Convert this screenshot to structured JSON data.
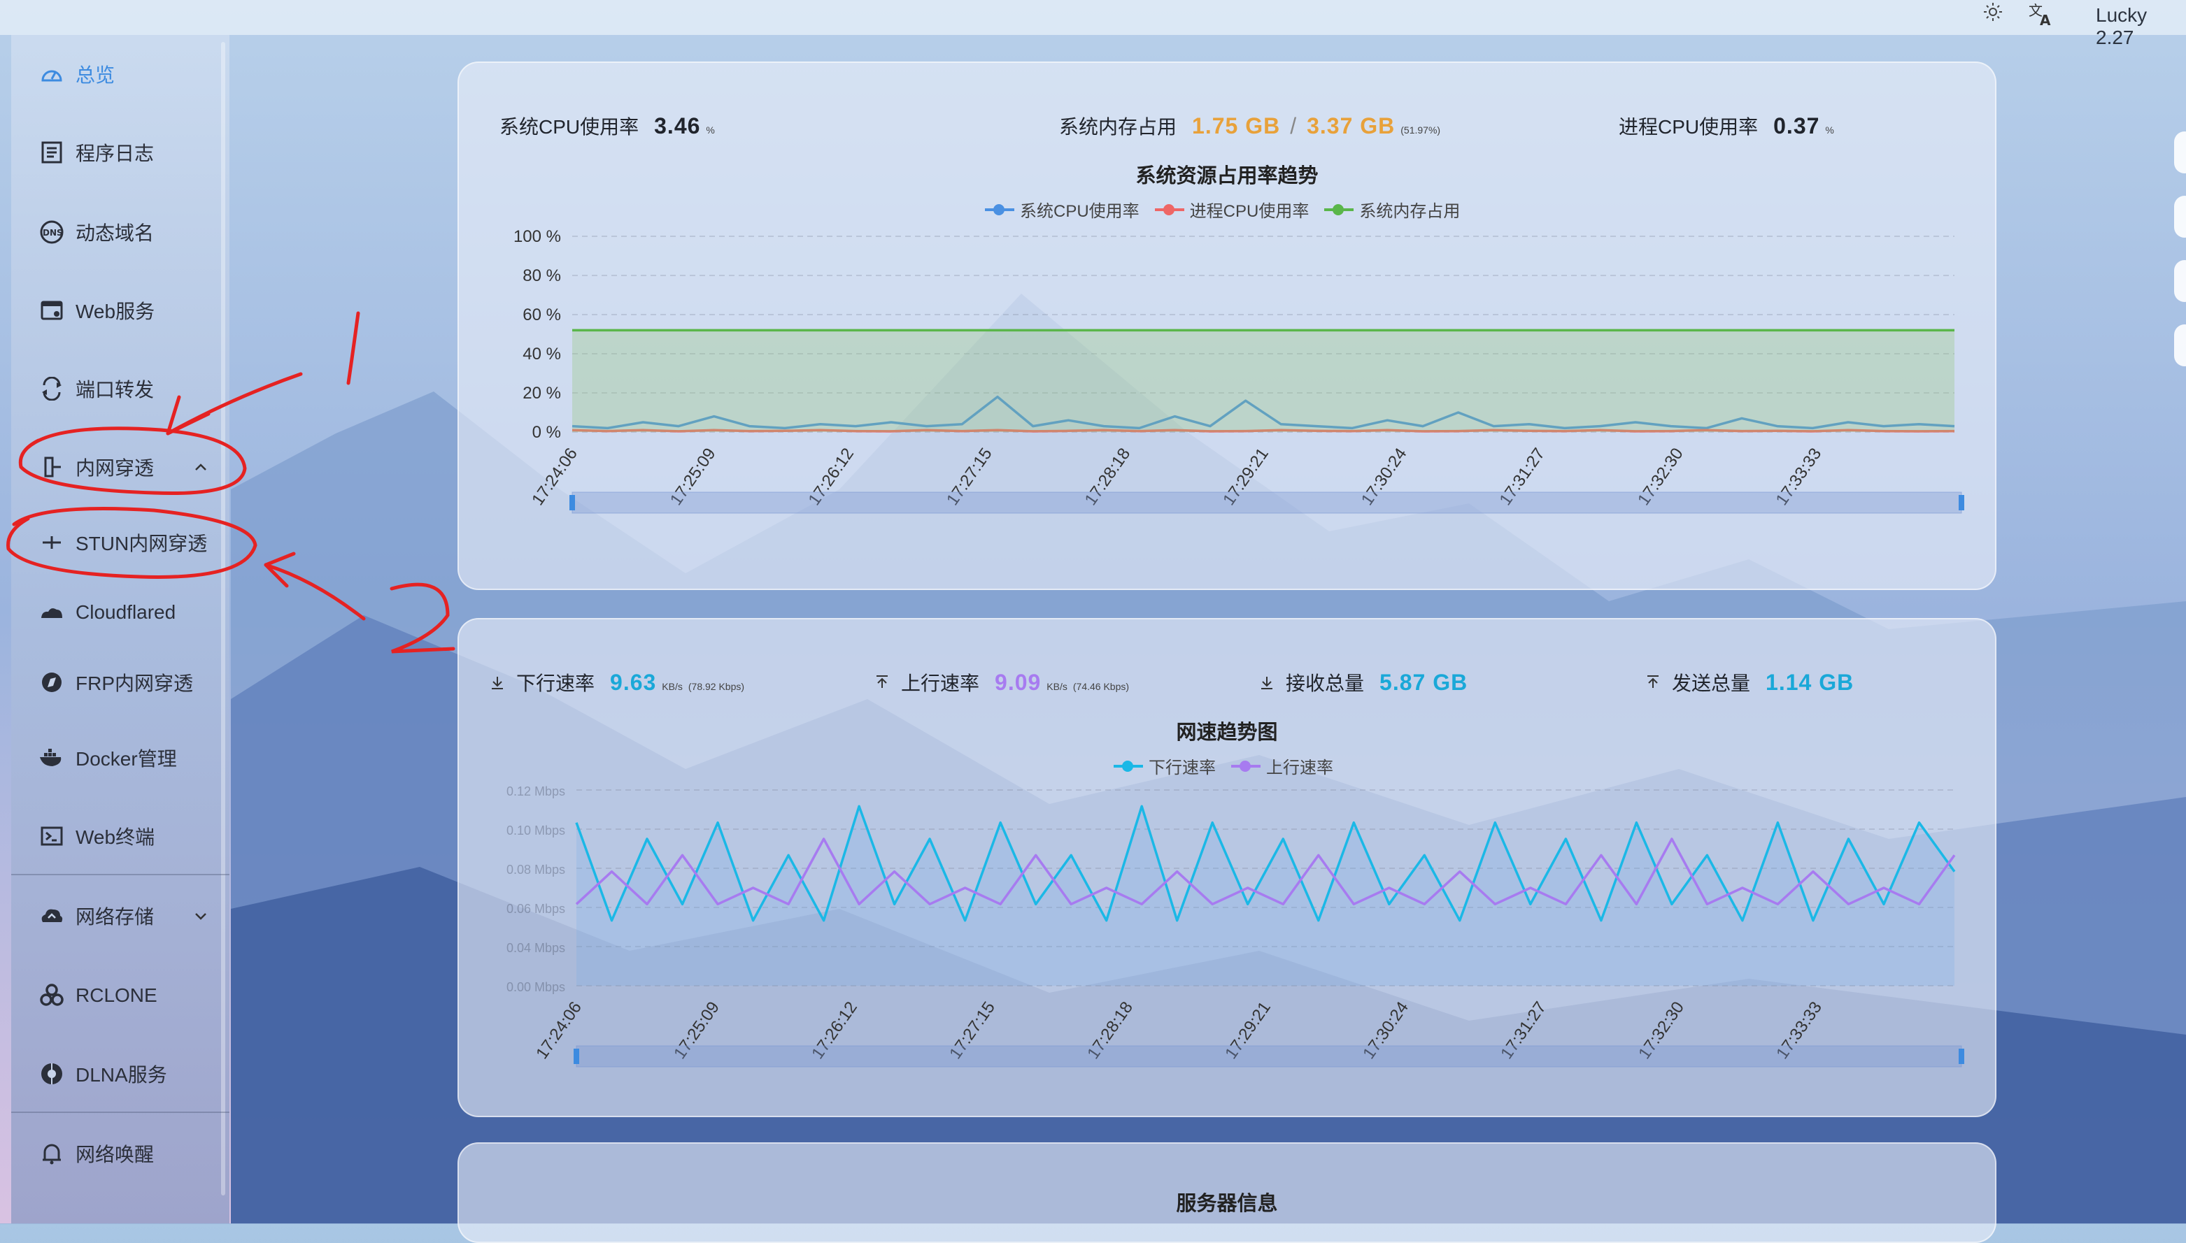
{
  "topbar": {
    "version": "Lucky 2.27",
    "theme_icon": "sun-icon",
    "lang_icon": "translate-icon"
  },
  "sidebar": {
    "items": [
      {
        "label": "总览",
        "icon": "dashboard-icon",
        "active": true
      },
      {
        "label": "程序日志",
        "icon": "log-icon"
      },
      {
        "label": "动态域名",
        "icon": "dns-icon"
      },
      {
        "label": "Web服务",
        "icon": "web-service-icon"
      },
      {
        "label": "端口转发",
        "icon": "port-forward-icon"
      },
      {
        "label": "内网穿透",
        "icon": "tunnel-icon",
        "expanded": true
      },
      {
        "label": "STUN内网穿透",
        "icon": "stun-icon"
      },
      {
        "label": "Cloudflared",
        "icon": "cloudflare-icon"
      },
      {
        "label": "FRP内网穿透",
        "icon": "frp-icon"
      },
      {
        "label": "Docker管理",
        "icon": "docker-icon"
      },
      {
        "label": "Web终端",
        "icon": "terminal-icon"
      },
      {
        "label": "网络存储",
        "icon": "cloud-storage-icon",
        "expandable": true
      },
      {
        "label": "RCLONE",
        "icon": "rclone-icon"
      },
      {
        "label": "DLNA服务",
        "icon": "dlna-icon"
      },
      {
        "label": "网络唤醒",
        "icon": "bell-icon"
      }
    ]
  },
  "system_card": {
    "cpu_label": "系统CPU使用率",
    "cpu_value": "3.46",
    "cpu_unit": "%",
    "mem_label": "系统内存占用",
    "mem_used": "1.75 GB",
    "mem_sep": "/",
    "mem_total": "3.37 GB",
    "mem_pct": "(51.97%)",
    "proc_label": "进程CPU使用率",
    "proc_value": "0.37",
    "proc_unit": "%",
    "chart_title": "系统资源占用率趋势",
    "legend": [
      "系统CPU使用率",
      "进程CPU使用率",
      "系统内存占用"
    ],
    "colors": {
      "cpu": "#4a90e2",
      "proc": "#ee6666",
      "mem": "#5ab64a"
    }
  },
  "network_card": {
    "down_label": "下行速率",
    "down_value": "9.63",
    "down_unit": "KB/s",
    "down_kbps": "(78.92 Kbps)",
    "up_label": "上行速率",
    "up_value": "9.09",
    "up_unit": "KB/s",
    "up_kbps": "(74.46 Kbps)",
    "recv_label": "接收总量",
    "recv_value": "5.87 GB",
    "sent_label": "发送总量",
    "sent_value": "1.14 GB",
    "chart_title": "网速趋势图",
    "legend": [
      "下行速率",
      "上行速率"
    ],
    "colors": {
      "down": "#1bb8e6",
      "up": "#a77bf0",
      "value": "#1aa8d8",
      "up_value": "#a77bf0",
      "mem": "#e8a13a"
    }
  },
  "server_card": {
    "title": "服务器信息"
  },
  "chart_data": [
    {
      "type": "line",
      "title": "系统资源占用率趋势",
      "ylim": [
        0,
        100
      ],
      "yticks": [
        "100 %",
        "80 %",
        "60 %",
        "40 %",
        "20 %",
        "0 %"
      ],
      "categories": [
        "17:24:06",
        "17:25:09",
        "17:26:12",
        "17:27:15",
        "17:28:18",
        "17:29:21",
        "17:30:24",
        "17:31:27",
        "17:32:30",
        "17:33:33"
      ],
      "series": [
        {
          "name": "系统CPU使用率",
          "values": [
            3,
            2,
            5,
            3,
            8,
            3,
            2,
            4,
            3,
            5,
            3,
            4,
            18,
            3,
            6,
            3,
            2,
            8,
            3,
            16,
            4,
            3,
            2,
            6,
            3,
            10,
            3,
            4,
            2,
            3,
            5,
            3,
            2,
            7,
            3,
            2,
            5,
            3,
            4,
            3
          ]
        },
        {
          "name": "进程CPU使用率",
          "values": [
            1,
            0.5,
            1,
            0.4,
            1,
            0.5,
            0.6,
            1,
            0.5,
            0.4,
            1,
            0.5,
            1,
            0.4,
            0.6,
            1,
            0.5,
            1,
            0.4,
            0.5,
            1,
            0.6,
            0.5,
            1,
            0.4,
            0.5,
            1,
            0.6,
            0.5,
            1,
            0.4,
            0.5,
            1,
            0.5,
            0.6,
            0.4,
            1,
            0.5,
            0.4,
            0.5
          ]
        },
        {
          "name": "系统内存占用",
          "values": [
            52,
            52,
            52,
            52,
            52,
            52,
            52,
            52,
            52,
            52,
            52,
            52,
            52,
            52,
            52,
            52,
            52,
            52,
            52,
            52,
            52,
            52,
            52,
            52,
            52,
            52,
            52,
            52,
            52,
            52,
            52,
            52,
            52,
            52,
            52,
            52,
            52,
            52,
            52,
            52
          ]
        }
      ]
    },
    {
      "type": "line",
      "title": "网速趋势图",
      "ylim": [
        0,
        0.12
      ],
      "yticks": [
        "0.12 Mbps",
        "0.10 Mbps",
        "0.08 Mbps",
        "0.06 Mbps",
        "0.04 Mbps",
        "0.00 Mbps"
      ],
      "categories": [
        "17:24:06",
        "17:25:09",
        "17:26:12",
        "17:27:15",
        "17:28:18",
        "17:29:21",
        "17:30:24",
        "17:31:27",
        "17:32:30",
        "17:33:33"
      ],
      "series": [
        {
          "name": "下行速率",
          "values": [
            0.1,
            0.04,
            0.09,
            0.05,
            0.1,
            0.04,
            0.08,
            0.04,
            0.11,
            0.05,
            0.09,
            0.04,
            0.1,
            0.05,
            0.08,
            0.04,
            0.11,
            0.04,
            0.1,
            0.05,
            0.09,
            0.04,
            0.1,
            0.05,
            0.08,
            0.04,
            0.1,
            0.05,
            0.09,
            0.04,
            0.1,
            0.05,
            0.08,
            0.04,
            0.1,
            0.04,
            0.09,
            0.05,
            0.1,
            0.07
          ]
        },
        {
          "name": "上行速率",
          "values": [
            0.05,
            0.07,
            0.05,
            0.08,
            0.05,
            0.06,
            0.05,
            0.09,
            0.05,
            0.07,
            0.05,
            0.06,
            0.05,
            0.08,
            0.05,
            0.06,
            0.05,
            0.07,
            0.05,
            0.06,
            0.05,
            0.08,
            0.05,
            0.06,
            0.05,
            0.07,
            0.05,
            0.06,
            0.05,
            0.08,
            0.05,
            0.09,
            0.05,
            0.06,
            0.05,
            0.07,
            0.05,
            0.06,
            0.05,
            0.08
          ]
        }
      ]
    }
  ]
}
